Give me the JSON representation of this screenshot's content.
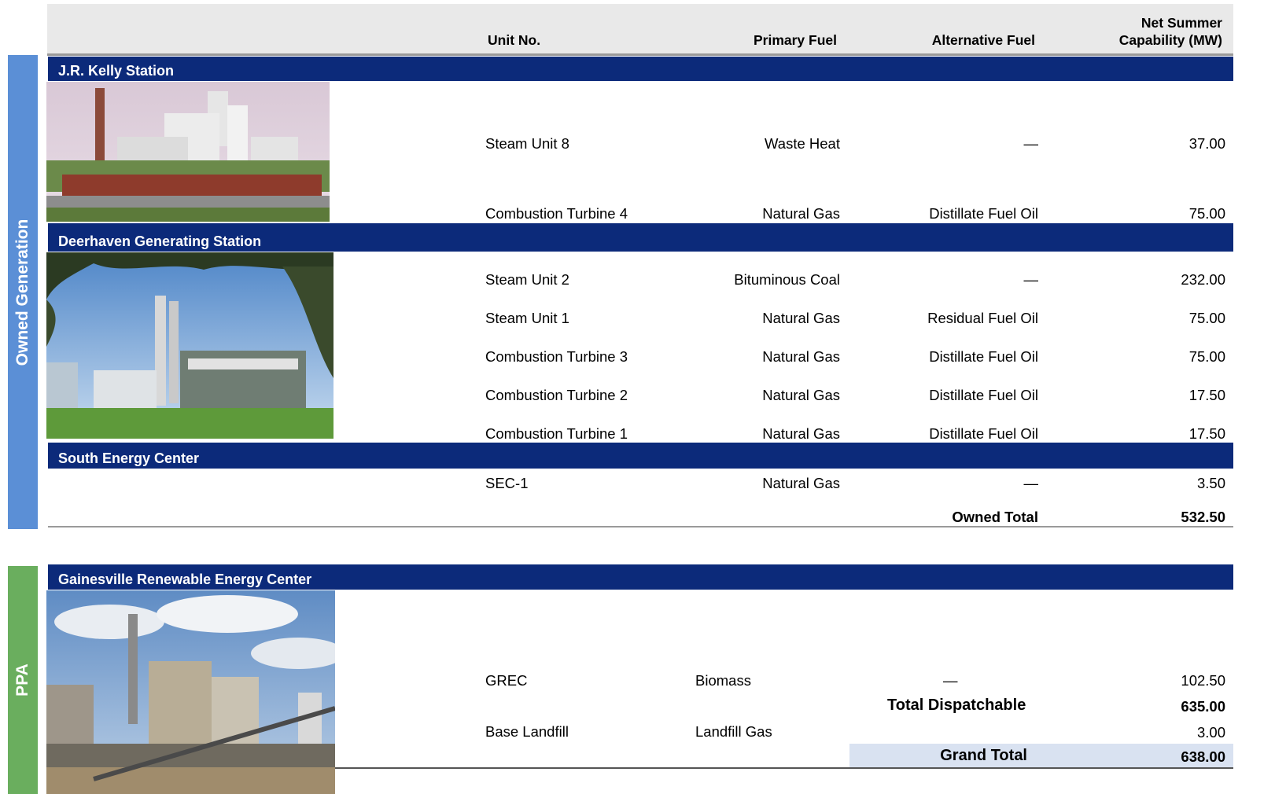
{
  "header": {
    "unit_no": "Unit No.",
    "primary_fuel": "Primary Fuel",
    "alternative_fuel": "Alternative Fuel",
    "capability_line1": "Net Summer",
    "capability_line2": "Capability (MW)"
  },
  "owned": {
    "side_label": "Owned Generation",
    "side_color": "#5b8fd6",
    "stations": [
      {
        "name": "J.R. Kelly Station",
        "units": [
          {
            "unit": "Steam Unit 8",
            "primary": "Waste Heat",
            "alternative": "—",
            "capability": "37.00"
          },
          {
            "unit": "Combustion Turbine 4",
            "primary": "Natural Gas",
            "alternative": "Distillate Fuel Oil",
            "capability": "75.00"
          }
        ]
      },
      {
        "name": "Deerhaven Generating Station",
        "units": [
          {
            "unit": "Steam Unit 2",
            "primary": "Bituminous Coal",
            "alternative": "—",
            "capability": "232.00"
          },
          {
            "unit": "Steam Unit 1",
            "primary": "Natural Gas",
            "alternative": "Residual Fuel Oil",
            "capability": "75.00"
          },
          {
            "unit": "Combustion Turbine 3",
            "primary": "Natural Gas",
            "alternative": "Distillate Fuel Oil",
            "capability": "75.00"
          },
          {
            "unit": "Combustion Turbine 2",
            "primary": "Natural Gas",
            "alternative": "Distillate Fuel Oil",
            "capability": "17.50"
          },
          {
            "unit": "Combustion Turbine 1",
            "primary": "Natural Gas",
            "alternative": "Distillate Fuel Oil",
            "capability": "17.50"
          }
        ]
      },
      {
        "name": "South Energy Center",
        "units": [
          {
            "unit": "SEC-1",
            "primary": "Natural Gas",
            "alternative": "—",
            "capability": "3.50"
          }
        ]
      }
    ],
    "total_label": "Owned Total",
    "total_value": "532.50"
  },
  "ppa": {
    "side_label": "PPA",
    "side_color": "#6aae5e",
    "station": "Gainesville Renewable Energy Center",
    "units": [
      {
        "unit": "GREC",
        "primary": "Biomass",
        "alternative": "—",
        "capability": "102.50"
      },
      {
        "unit": "Base Landfill",
        "primary": "Landfill Gas",
        "alternative": "",
        "capability": "3.00"
      }
    ],
    "dispatchable_label": "Total Dispatchable",
    "dispatchable_value": "635.00",
    "grand_total_label": "Grand Total",
    "grand_total_value": "638.00",
    "grand_total_bg": "#d9e2f1"
  },
  "colors": {
    "band": "#0c2a7a",
    "header_bg": "#e9e9e9"
  },
  "icons": [
    "kelly-station-photo",
    "deerhaven-station-photo",
    "grec-station-photo"
  ]
}
